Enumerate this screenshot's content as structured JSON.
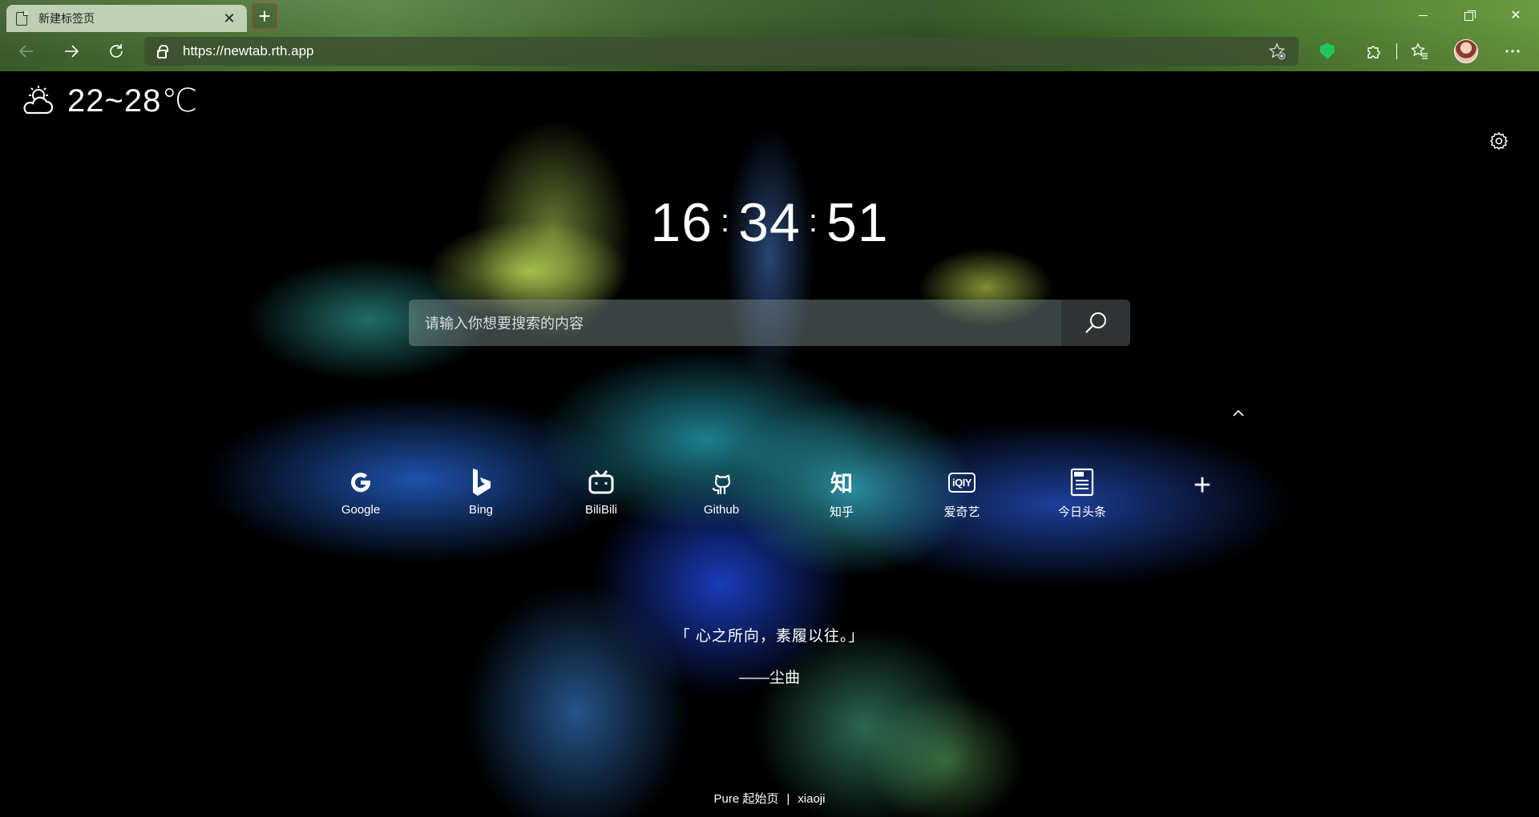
{
  "browser": {
    "tab_title": "新建标签页",
    "tab_close": "✕",
    "new_tab": "+",
    "url": "https://newtab.rth.app"
  },
  "weather": {
    "temperature": "22~28℃",
    "icon": "partly-cloudy-icon"
  },
  "clock": {
    "hours": "16",
    "minutes": "34",
    "seconds": "51",
    "separator": ":"
  },
  "search": {
    "placeholder": "请输入你想要搜索的内容"
  },
  "shortcuts": [
    {
      "label": "Google",
      "icon": "google-icon"
    },
    {
      "label": "Bing",
      "icon": "bing-icon"
    },
    {
      "label": "BiliBili",
      "icon": "bilibili-icon"
    },
    {
      "label": "Github",
      "icon": "github-icon"
    },
    {
      "label": "知乎",
      "icon": "zhihu-icon",
      "glyph": "知"
    },
    {
      "label": "爱奇艺",
      "icon": "iqiyi-icon",
      "glyph": "iQIY"
    },
    {
      "label": "今日头条",
      "icon": "toutiao-icon"
    },
    {
      "label": "",
      "icon": "add-icon",
      "glyph": "+"
    }
  ],
  "quote": {
    "text": "「 心之所向，素履以往。」",
    "author": "——尘曲"
  },
  "footer": {
    "brand": "Pure 起始页",
    "separator": "|",
    "author": "xiaoji"
  }
}
